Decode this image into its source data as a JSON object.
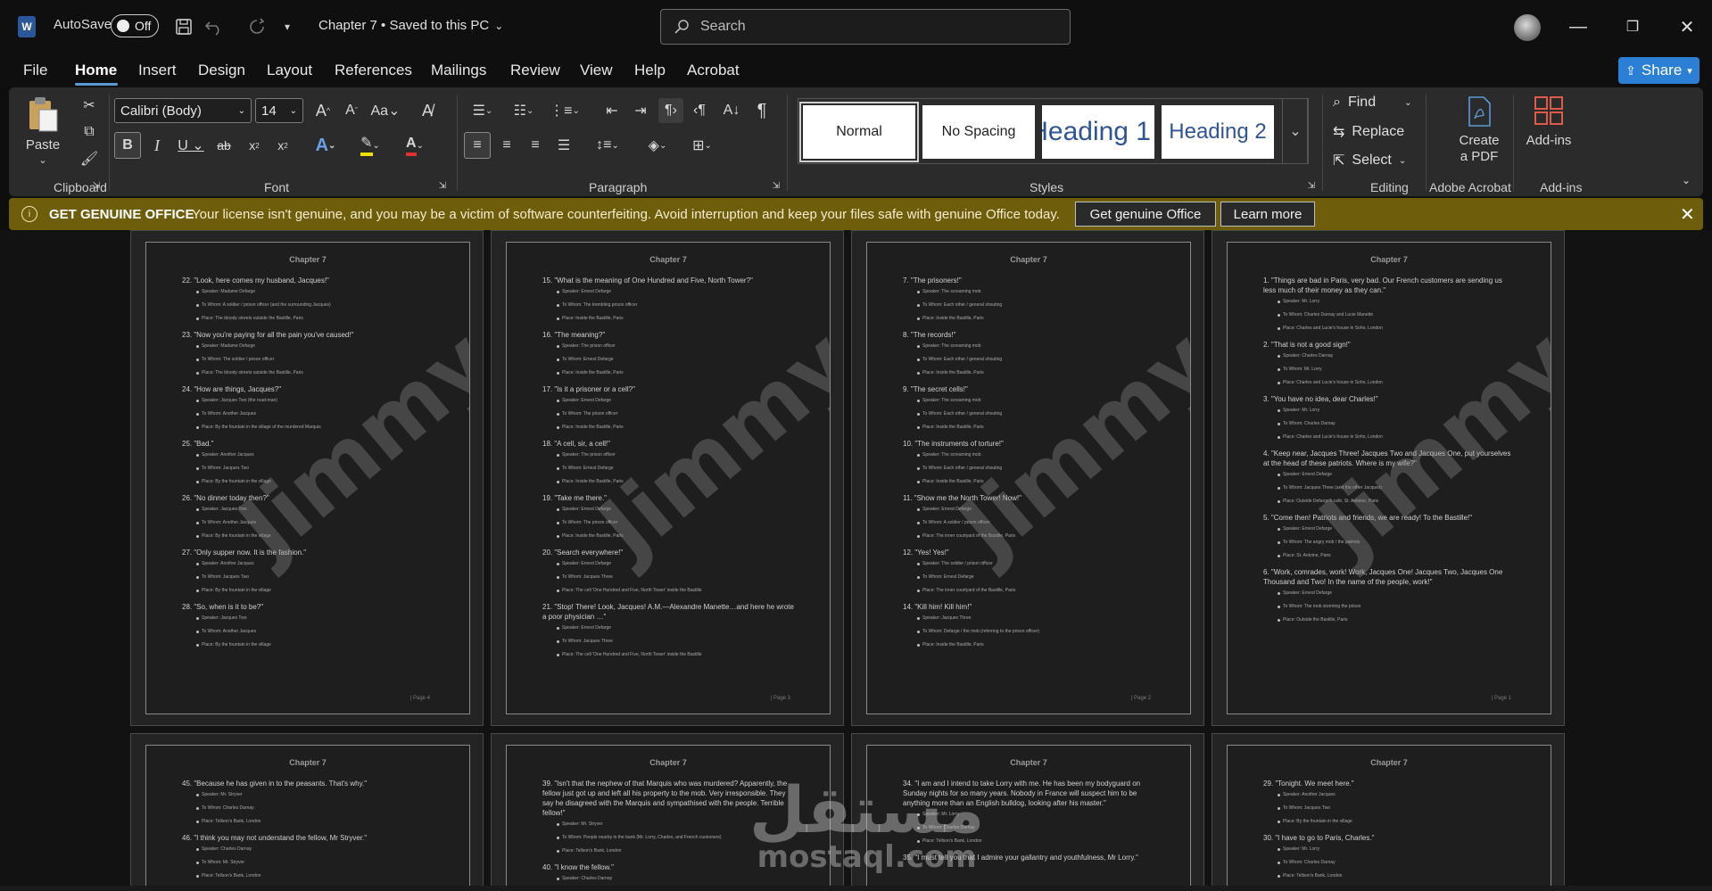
{
  "titlebar": {
    "app_logo": "W",
    "autosave_label": "AutoSave",
    "autosave_state": "Off",
    "doc_title": "Chapter 7 • Saved to this PC",
    "search_placeholder": "Search",
    "icons": [
      "save-icon",
      "undo-icon",
      "redo-icon",
      "customize-qat-icon"
    ],
    "window_buttons": [
      "minimize",
      "restore",
      "close"
    ]
  },
  "menu": {
    "items": [
      "File",
      "Home",
      "Insert",
      "Design",
      "Layout",
      "References",
      "Mailings",
      "Review",
      "View",
      "Help",
      "Acrobat"
    ],
    "active": "Home",
    "share_label": "Share"
  },
  "ribbon": {
    "clipboard": {
      "paste_label": "Paste",
      "group_label": "Clipboard"
    },
    "font": {
      "font_name": "Calibri (Body)",
      "font_size": "14",
      "group_label": "Font"
    },
    "paragraph": {
      "group_label": "Paragraph"
    },
    "styles": {
      "items": [
        "Normal",
        "No Spacing",
        "Heading 1",
        "Heading 2"
      ],
      "group_label": "Styles"
    },
    "editing": {
      "find_label": "Find",
      "replace_label": "Replace",
      "select_label": "Select",
      "group_label": "Editing"
    },
    "acrobat": {
      "create_pdf_label_1": "Create",
      "create_pdf_label_2": "a PDF",
      "group_label": "Adobe Acrobat"
    },
    "addins": {
      "addins_label": "Add-ins",
      "group_label": "Add-ins"
    }
  },
  "license_bar": {
    "title": "GET GENUINE OFFICE",
    "message": "Your license isn't genuine, and you may be a victim of software counterfeiting. Avoid interruption and keep your files safe with genuine Office today.",
    "btn_genuine": "Get genuine Office",
    "btn_learn": "Learn more"
  },
  "watermark": "Jimmy",
  "overlay_logo": {
    "arabic": "مستقل",
    "latin": "mostaql.com"
  },
  "pages": [
    {
      "header": "Chapter 7",
      "footer": "| Page 4",
      "items": [
        {
          "q": "22. \"Look, here comes my husband, Jacques!\"",
          "b": [
            "Speaker: Madame Defarge",
            "To Whom: A soldier / prison officer (and the surrounding Jacques)",
            "Place: The bloody streets outside the Bastille, Paris"
          ]
        },
        {
          "q": "23. \"Now you're paying for all the pain you've caused!\"",
          "b": [
            "Speaker: Madame Defarge",
            "To Whom: The soldier / prison officer",
            "Place: The bloody streets outside the Bastille, Paris"
          ]
        },
        {
          "q": "24. \"How are things, Jacques?\"",
          "b": [
            "Speaker: Jacques Two (the road-man)",
            "To Whom: Another Jacques",
            "Place: By the fountain in the village of the murdered Marquis"
          ]
        },
        {
          "q": "25. \"Bad.\"",
          "b": [
            "Speaker: Another Jacques",
            "To Whom: Jacques Two",
            "Place: By the fountain in the village"
          ]
        },
        {
          "q": "26. \"No dinner today then?\"",
          "b": [
            "Speaker: Jacques Two",
            "To Whom: Another Jacques",
            "Place: By the fountain in the village"
          ]
        },
        {
          "q": "27. \"Only supper now. It is the fashion.\"",
          "b": [
            "Speaker: Another Jacques",
            "To Whom: Jacques Two",
            "Place: By the fountain in the village"
          ]
        },
        {
          "q": "28. \"So, when is it to be?\"",
          "b": [
            "Speaker: Jacques Two",
            "To Whom: Another Jacques",
            "Place: By the fountain in the village"
          ]
        }
      ]
    },
    {
      "header": "Chapter 7",
      "footer": "| Page 3",
      "items": [
        {
          "q": "15. \"What is the meaning of One Hundred and Five, North Tower?\"",
          "b": [
            "Speaker: Ernest Defarge",
            "To Whom: The trembling prison officer",
            "Place: Inside the Bastille, Paris"
          ]
        },
        {
          "q": "16. \"The meaning?\"",
          "b": [
            "Speaker: The prison officer",
            "To Whom: Ernest Defarge",
            "Place: Inside the Bastille, Paris"
          ]
        },
        {
          "q": "17. \"Is it a prisoner or a cell?\"",
          "b": [
            "Speaker: Ernest Defarge",
            "To Whom: The prison officer",
            "Place: Inside the Bastille, Paris"
          ]
        },
        {
          "q": "18. \"A cell, sir, a cell!\"",
          "b": [
            "Speaker: The prison officer",
            "To Whom: Ernest Defarge",
            "Place: Inside the Bastille, Paris"
          ]
        },
        {
          "q": "19. \"Take me there.\"",
          "b": [
            "Speaker: Ernest Defarge",
            "To Whom: The prison officer",
            "Place: Inside the Bastille, Paris"
          ]
        },
        {
          "q": "20. \"Search everywhere!\"",
          "b": [
            "Speaker: Ernest Defarge",
            "To Whom: Jacques Three",
            "Place: The cell 'One Hundred and Five, North Tower' inside the Bastille"
          ]
        },
        {
          "q": "21. \"Stop! There! Look, Jacques! A.M.—Alexandre Manette…and here he wrote a poor physician …\"",
          "b": [
            "Speaker: Ernest Defarge",
            "To Whom: Jacques Three",
            "Place: The cell 'One Hundred and Five, North Tower' inside the Bastille"
          ]
        }
      ]
    },
    {
      "header": "Chapter 7",
      "footer": "| Page 2",
      "items": [
        {
          "q": "7. \"The prisoners!\"",
          "b": [
            "Speaker: The screaming mob",
            "To Whom: Each other / general shouting",
            "Place: Inside the Bastille, Paris"
          ]
        },
        {
          "q": "8. \"The records!\"",
          "b": [
            "Speaker: The screaming mob",
            "To Whom: Each other / general shouting",
            "Place: Inside the Bastille, Paris"
          ]
        },
        {
          "q": "9. \"The secret cells!\"",
          "b": [
            "Speaker: The screaming mob",
            "To Whom: Each other / general shouting",
            "Place: Inside the Bastille, Paris"
          ]
        },
        {
          "q": "10. \"The instruments of torture!\"",
          "b": [
            "Speaker: The screaming mob",
            "To Whom: Each other / general shouting",
            "Place: Inside the Bastille, Paris"
          ]
        },
        {
          "q": "11. \"Show me the North Tower! Now!\"",
          "b": [
            "Speaker: Ernest Defarge",
            "To Whom: A soldier / prison officer",
            "Place: The inner courtyard of the Bastille, Paris"
          ]
        },
        {
          "q": "12. \"Yes! Yes!\"",
          "b": [
            "Speaker: The soldier / prison officer",
            "To Whom: Ernest Defarge",
            "Place: The inner courtyard of the Bastille, Paris"
          ]
        },
        {
          "q": "14. \"Kill him! Kill him!\"",
          "b": [
            "Speaker: Jacques Three",
            "To Whom: Defarge / the mob (referring to the prison officer)",
            "Place: Inside the Bastille, Paris"
          ]
        }
      ]
    },
    {
      "header": "Chapter 7",
      "footer": "| Page 1",
      "items": [
        {
          "q": "1. \"Things are bad in Paris, very bad. Our French customers are sending us less much of their money as they can.\"",
          "b": [
            "Speaker: Mr. Lorry",
            "To Whom: Charles Darnay and Lucie Manette",
            "Place: Charles and Lucie's house in Soho, London"
          ]
        },
        {
          "q": "2. \"That is not a good sign!\"",
          "b": [
            "Speaker: Charles Darnay",
            "To Whom: Mr. Lorry",
            "Place: Charles and Lucie's house in Soho, London"
          ]
        },
        {
          "q": "3. \"You have no idea, dear Charles!\"",
          "b": [
            "Speaker: Mr. Lorry",
            "To Whom: Charles Darnay",
            "Place: Charles and Lucie's house in Soho, London"
          ]
        },
        {
          "q": "4. \"Keep near, Jacques Three! Jacques Two and Jacques One, put yourselves at the head of these patriots. Where is my wife?\"",
          "b": [
            "Speaker: Ernest Defarge",
            "To Whom: Jacques Three (and the other Jacques)",
            "Place: Outside Defarge's café, St. Antoine, Paris"
          ]
        },
        {
          "q": "5. \"Come then! Patriots and friends, we are ready! To the Bastille!\"",
          "b": [
            "Speaker: Ernest Defarge",
            "To Whom: The angry mob / the patriots",
            "Place: St. Antoine, Paris"
          ]
        },
        {
          "q": "6. \"Work, comrades, work! Work, Jacques One! Jacques Two, Jacques One Thousand and Two! In the name of the people, work!\"",
          "b": [
            "Speaker: Ernest Defarge",
            "To Whom: The mob storming the prison",
            "Place: Outside the Bastille, Paris"
          ]
        }
      ]
    },
    {
      "header": "Chapter 7",
      "footer": "",
      "items": [
        {
          "q": "45. \"Because he has given in to the peasants. That's why.\"",
          "b": [
            "Speaker: Mr. Stryver",
            "To Whom: Charles Darnay",
            "Place: Tellson's Bank, London"
          ]
        },
        {
          "q": "46. \"I think you may not understand the fellow, Mr Stryver.\"",
          "b": [
            "Speaker: Charles Darnay",
            "To Whom: Mr. Stryver",
            "Place: Tellson's Bank, London"
          ]
        }
      ]
    },
    {
      "header": "Chapter 7",
      "footer": "",
      "items": [
        {
          "q": "39. \"Isn't that the nephew of that Marquis who was murdered? Apparently, the fellow just got up and left all his property to the mob. Very irresponsible. They say he disagreed with the Marquis and sympathised with the people. Terrible fellow!\"",
          "b": [
            "Speaker: Mr. Stryver",
            "To Whom: People nearby in the bank (Mr. Lorry, Charles, and French customers)",
            "Place: Tellson's Bank, London"
          ]
        },
        {
          "q": "40. \"I know the fellow.\"",
          "b": [
            "Speaker: Charles Darnay"
          ]
        }
      ]
    },
    {
      "header": "Chapter 7",
      "footer": "",
      "items": [
        {
          "q": "34. \"I am and I intend to take Lorry with me. He has been my bodyguard on Sunday nights for so many years. Nobody in France will suspect him to be anything more than an English bulldog, looking after his master.\"",
          "b": [
            "Speaker: Mr. Lorry",
            "To Whom: Charles Darnay",
            "Place: Tellson's Bank, London"
          ]
        },
        {
          "q": "35. \"I must tell you that I admire your gallantry and youthfulness, Mr Lorry.\"",
          "b": []
        }
      ]
    },
    {
      "header": "Chapter 7",
      "footer": "",
      "items": [
        {
          "q": "29. \"Tonight. We meet here.\"",
          "b": [
            "Speaker: Another Jacques",
            "To Whom: Jacques Two",
            "Place: By the fountain in the village"
          ]
        },
        {
          "q": "30. \"I have to go to Paris, Charles.\"",
          "b": [
            "Speaker: Mr. Lorry",
            "To Whom: Charles Darnay",
            "Place: Tellson's Bank, London"
          ]
        }
      ]
    }
  ]
}
